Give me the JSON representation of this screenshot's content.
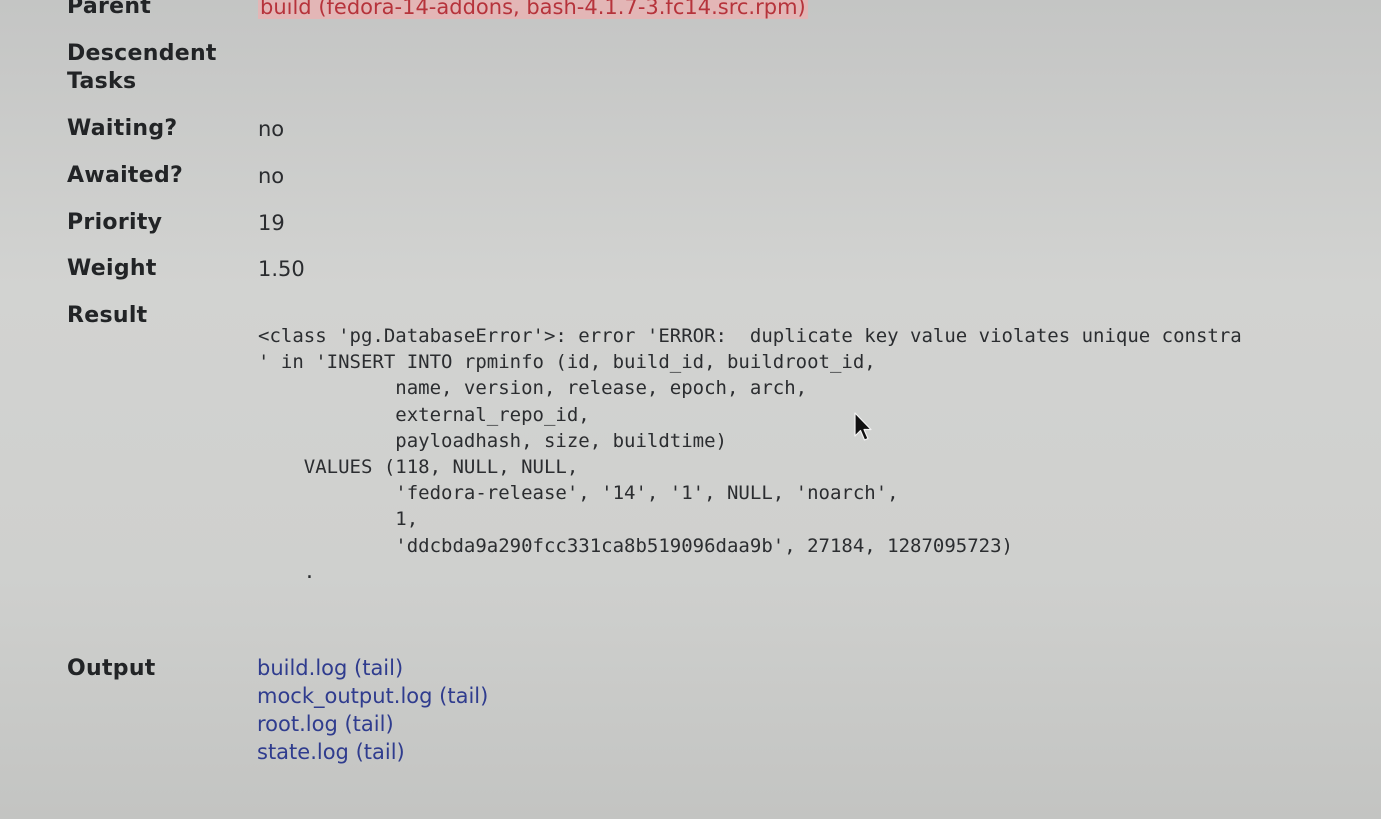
{
  "fields": {
    "parent": {
      "label": "Parent",
      "value": "build (fedora-14-addons, bash-4.1.7-3.fc14.src.rpm)"
    },
    "descendent_tasks": {
      "label_line1": "Descendent",
      "label_line2": "Tasks",
      "value": ""
    },
    "waiting": {
      "label": "Waiting?",
      "value": "no"
    },
    "awaited": {
      "label": "Awaited?",
      "value": "no"
    },
    "priority": {
      "label": "Priority",
      "value": "19"
    },
    "weight": {
      "label": "Weight",
      "value": "1.50"
    },
    "result": {
      "label": "Result",
      "text": "<class 'pg.DatabaseError'>: error 'ERROR:  duplicate key value violates unique constra\n' in 'INSERT INTO rpminfo (id, build_id, buildroot_id,\n            name, version, release, epoch, arch,\n            external_repo_id,\n            payloadhash, size, buildtime)\n    VALUES (118, NULL, NULL,\n            'fedora-release', '14', '1', NULL, 'noarch',\n            1,\n            'ddcbda9a290fcc331ca8b519096daa9b', 27184, 1287095723)\n    ."
    },
    "output": {
      "label": "Output",
      "items": [
        {
          "file": "build.log",
          "tail": "(tail)"
        },
        {
          "file": "mock_output.log",
          "tail": "(tail)"
        },
        {
          "file": "root.log",
          "tail": "(tail)"
        },
        {
          "file": "state.log",
          "tail": "(tail)"
        }
      ]
    }
  },
  "colors": {
    "background": "#cbcccb",
    "label_text": "#222426",
    "link_blue": "#2f3c8e",
    "parent_link_red": "#b6333b",
    "parent_link_highlight": "#e3b6b6"
  },
  "icons": {
    "cursor": "mouse-pointer-icon"
  }
}
